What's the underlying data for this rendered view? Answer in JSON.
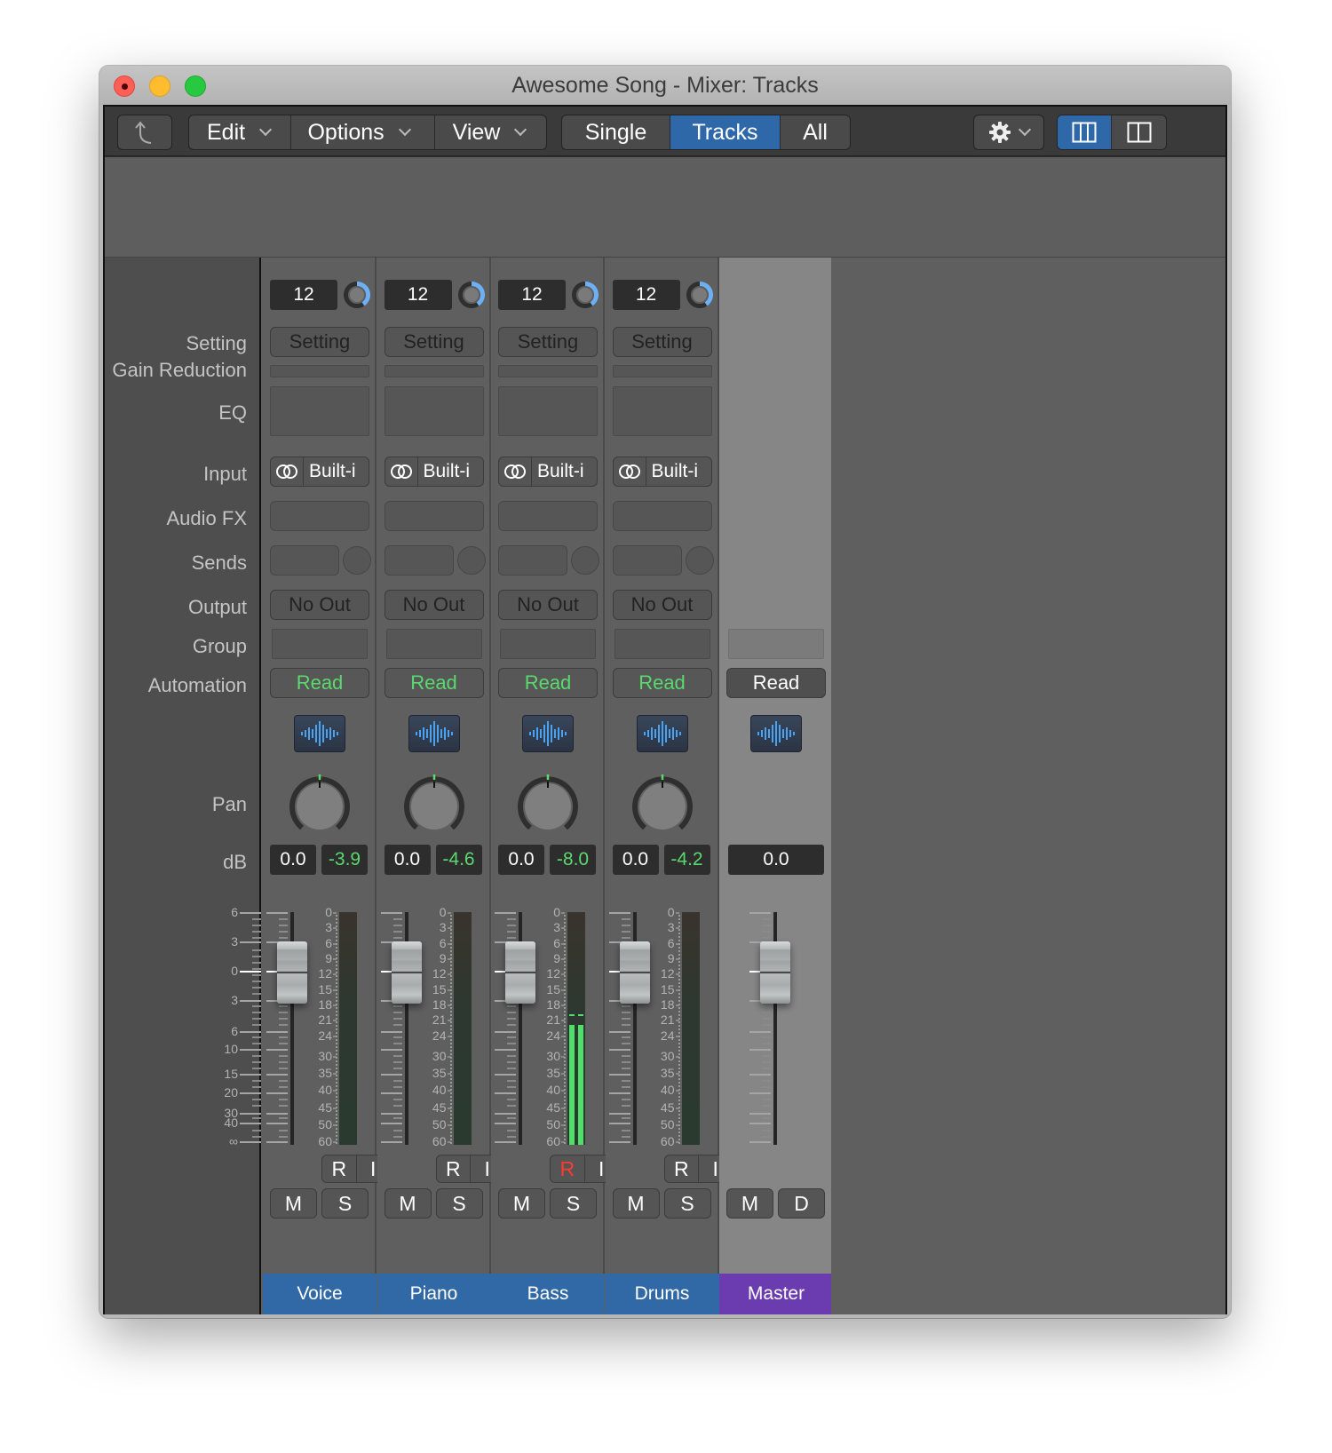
{
  "window": {
    "title": "Awesome Song - Mixer: Tracks"
  },
  "toolbar": {
    "back_icon": "back-arrow-icon",
    "menus": [
      {
        "label": "Edit"
      },
      {
        "label": "Options"
      },
      {
        "label": "View"
      }
    ],
    "view_modes": [
      {
        "label": "Single",
        "active": false
      },
      {
        "label": "Tracks",
        "active": true
      },
      {
        "label": "All",
        "active": false
      }
    ],
    "settings_icon": "gear-icon",
    "layout_buttons": [
      {
        "icon": "three-columns-icon",
        "active": true
      },
      {
        "icon": "two-columns-icon",
        "active": false
      }
    ],
    "accent_color": "#2f68a8"
  },
  "row_labels": {
    "setting": "Setting",
    "gain_reduction": "Gain Reduction",
    "eq": "EQ",
    "input": "Input",
    "audio_fx": "Audio FX",
    "sends": "Sends",
    "output": "Output",
    "group": "Group",
    "automation": "Automation",
    "pan": "Pan",
    "db": "dB"
  },
  "fader_scale": [
    "6",
    "3",
    "0",
    "3",
    "6",
    "10",
    "15",
    "20",
    "30",
    "40",
    "∞"
  ],
  "meter_scale": [
    "0",
    "3",
    "6",
    "9",
    "12",
    "15",
    "18",
    "21",
    "24",
    "30",
    "35",
    "40",
    "45",
    "50",
    "60"
  ],
  "channels": [
    {
      "name": "Voice",
      "type": "track",
      "num_value": "12",
      "setting": "Setting",
      "input": "Built-i",
      "output": "No Out",
      "automation": "Read",
      "pan": 0,
      "volume": "0.0",
      "peak": "-3.9",
      "meter_level_db": null,
      "record": "R",
      "input_mon": "I",
      "record_armed": false,
      "mute": "M",
      "solo": "S",
      "color": "#3169a6"
    },
    {
      "name": "Piano",
      "type": "track",
      "num_value": "12",
      "setting": "Setting",
      "input": "Built-i",
      "output": "No Out",
      "automation": "Read",
      "pan": 0,
      "volume": "0.0",
      "peak": "-4.6",
      "meter_level_db": null,
      "record": "R",
      "input_mon": "I",
      "record_armed": false,
      "mute": "M",
      "solo": "S",
      "color": "#3169a6"
    },
    {
      "name": "Bass",
      "type": "track",
      "num_value": "12",
      "setting": "Setting",
      "input": "Built-i",
      "output": "No Out",
      "automation": "Read",
      "pan": 0,
      "volume": "0.0",
      "peak": "-8.0",
      "meter_level_db": -22,
      "record": "R",
      "input_mon": "I",
      "record_armed": true,
      "mute": "M",
      "solo": "S",
      "color": "#3169a6"
    },
    {
      "name": "Drums",
      "type": "track",
      "num_value": "12",
      "setting": "Setting",
      "input": "Built-i",
      "output": "No Out",
      "automation": "Read",
      "pan": 0,
      "volume": "0.0",
      "peak": "-4.2",
      "meter_level_db": null,
      "record": "R",
      "input_mon": "I",
      "record_armed": false,
      "mute": "M",
      "solo": "S",
      "color": "#3169a6"
    }
  ],
  "master": {
    "name": "Master",
    "automation": "Read",
    "volume": "0.0",
    "mute": "M",
    "dim": "D",
    "color": "#6a3cb0"
  }
}
